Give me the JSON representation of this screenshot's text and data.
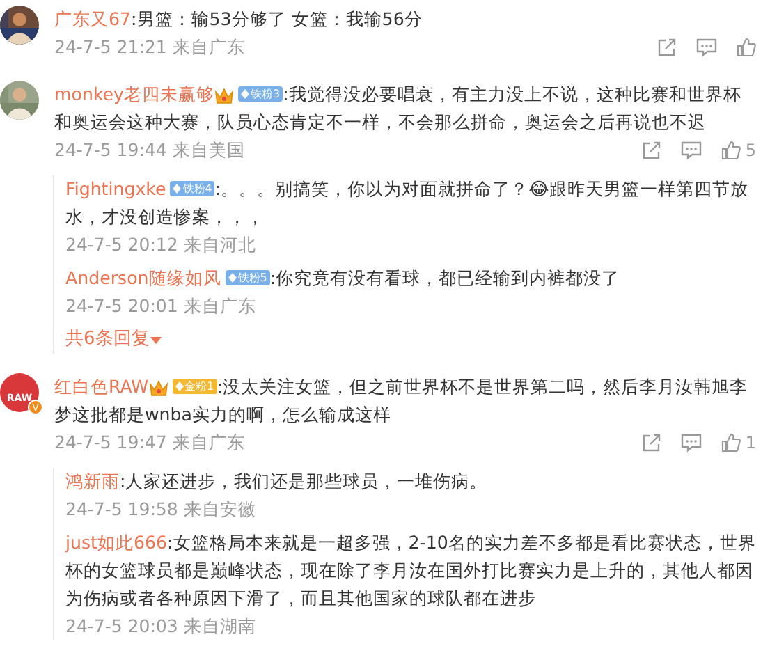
{
  "comments": [
    {
      "avatar": {
        "kind": "picture"
      },
      "user": "广东又67",
      "crown": false,
      "text": ":男篮：输53分够了 女篮：我输56分",
      "time": "24-7-5 21:21",
      "location": "来自广东"
    },
    {
      "avatar": {
        "kind": "picture"
      },
      "user": "monkey老四未赢够",
      "crown": true,
      "badge": {
        "text": "铁粉3",
        "color": "#79b0ea"
      },
      "text": ":我觉得没必要唱衰，有主力没上不说，这种比赛和世界杯和奥运会这种大赛，队员心态肯定不一样，不会那么拼命，奥运会之后再说也不迟",
      "time": "24-7-5 19:44",
      "location": "来自美国",
      "likes": "5",
      "replies": [
        {
          "user": "Fightingxke",
          "badge": {
            "text": "铁粉4",
            "color": "#79b0ea"
          },
          "text": ":。。。别搞笑，你以为对面就拼命了？😂跟昨天男篮一样第四节放水，才没创造惨案，，，",
          "time": "24-7-5 20:12",
          "location": "来自河北"
        },
        {
          "user": "Anderson随缘如风",
          "badge": {
            "text": "铁粉5",
            "color": "#79b0ea"
          },
          "text": ":你究竟有没有看球，都已经输到内裤都没了",
          "time": "24-7-5 20:01",
          "location": "来自广东"
        }
      ],
      "more_replies": "共6条回复"
    },
    {
      "avatar": {
        "kind": "logo",
        "text": "RAW",
        "verified": "V"
      },
      "user": "红白色RAW",
      "crown": true,
      "badge": {
        "text": "金粉1",
        "color": "#f4b731"
      },
      "text": ":没太关注女篮，但之前世界杯不是世界第二吗，然后李月汝韩旭李梦这批都是wnba实力的啊，怎么输成这样",
      "time": "24-7-5 19:47",
      "location": "来自广东",
      "likes": "1",
      "replies": [
        {
          "user": "鸿新雨",
          "text": ":人家还进步，我们还是那些球员，一堆伤病。",
          "time": "24-7-5 19:58",
          "location": "来自安徽"
        },
        {
          "user": "just如此666",
          "text": ":女篮格局本来就是一超多强，2-10名的实力差不多都是看比赛状态，世界杯的女篮球员都是巅峰状态，现在除了李月汝在国外打比赛实力是上升的，其他人都因为伤病或者各种原因下滑了，而且其他国家的球队都在进步",
          "time": "24-7-5 20:03",
          "location": "来自湖南"
        }
      ]
    }
  ]
}
